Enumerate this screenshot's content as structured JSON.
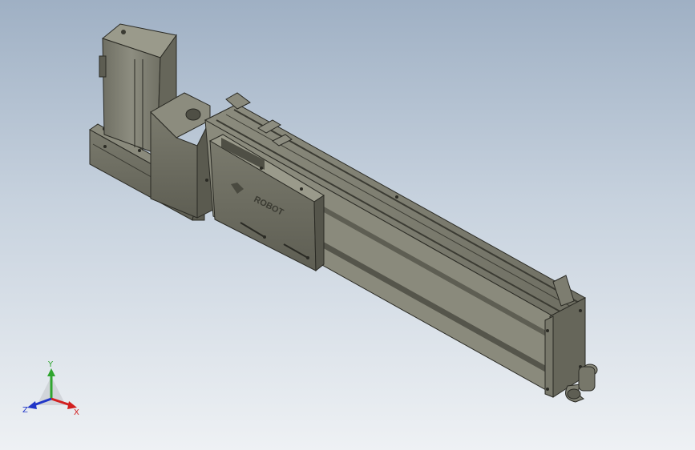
{
  "viewport": {
    "model_logo_text": "ROBOT",
    "background_top": "#9fb0c4",
    "background_bottom": "#eef1f4",
    "part_color": "#77776a"
  },
  "triad": {
    "x_label": "X",
    "y_label": "Y",
    "z_label": "Z",
    "x_color": "#d22020",
    "y_color": "#2fa52f",
    "z_color": "#2036c8"
  }
}
